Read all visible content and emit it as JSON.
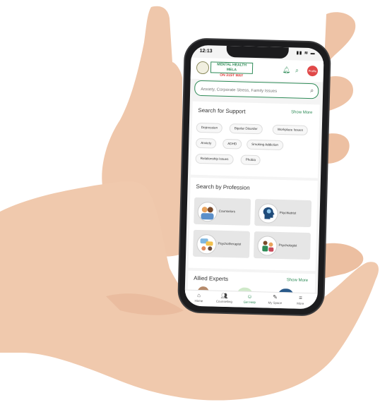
{
  "status": {
    "time": "12:13",
    "signal": "▮▮ ≋ ▬"
  },
  "header": {
    "logo_line1": "MENTAL HEALTH MELA",
    "logo_line2": "ON 31ST MAY",
    "avatar_label": "Profile"
  },
  "search": {
    "placeholder": "Anxiety, Corporate Stress, Family Issues"
  },
  "support": {
    "title": "Search for Support",
    "show_more": "Show More",
    "chips": [
      "Depression",
      "Bipolar Disorder",
      "Workplace Issues",
      "Anxiety",
      "ADHD",
      "Smoking Addiction",
      "Relationship Issues",
      "Phobia"
    ]
  },
  "profession": {
    "title": "Search by Profession",
    "tiles": [
      "Counselors",
      "Psychiatrist",
      "Psychotherapist",
      "Psychologist"
    ]
  },
  "allied": {
    "title": "Allied Experts",
    "show_more": "Show More"
  },
  "nav": {
    "items": [
      "Home",
      "Counselling",
      "Get Help",
      "My Space",
      "More"
    ],
    "active": 2
  },
  "colors": {
    "accent": "#2e8b57",
    "alert": "#e04848"
  }
}
